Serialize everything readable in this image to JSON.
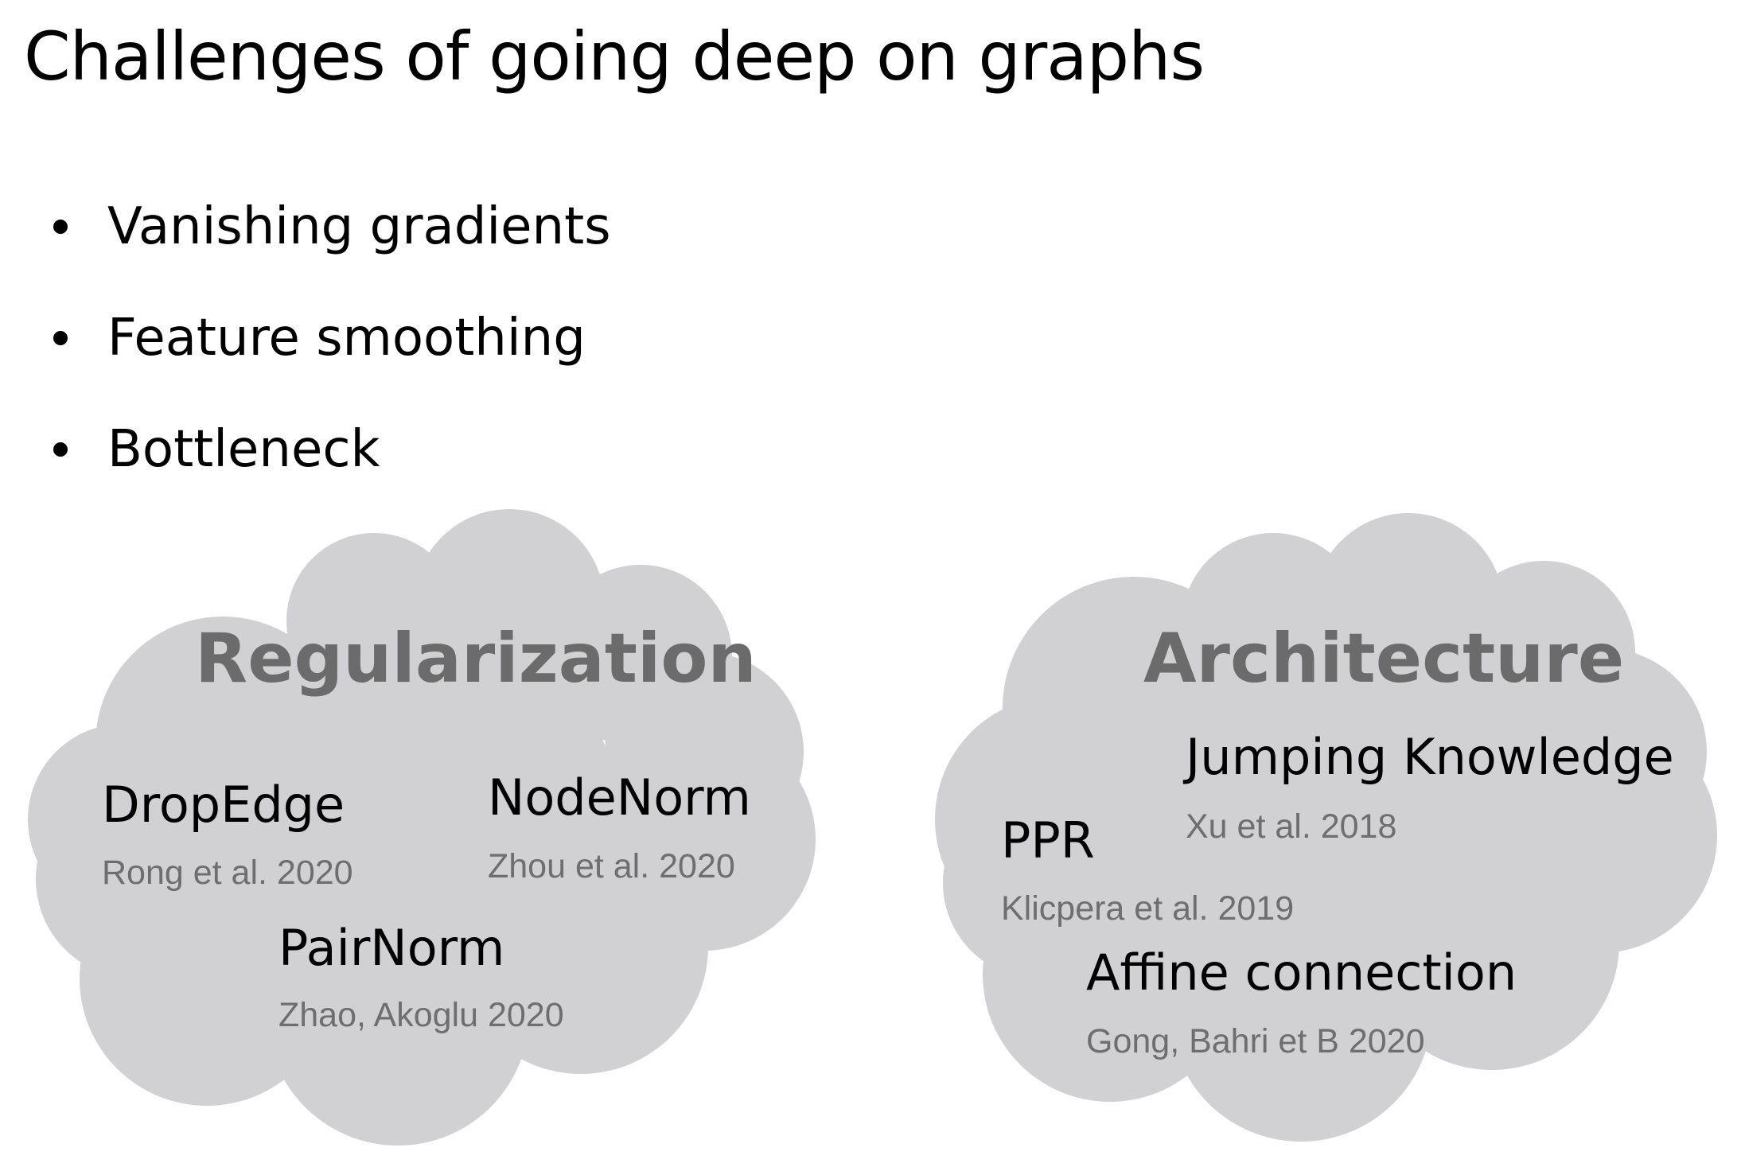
{
  "title": "Challenges of going deep on graphs",
  "bullets": [
    "Vanishing gradients",
    "Feature smoothing",
    "Bottleneck"
  ],
  "cloud_color": "#d1d1d3",
  "regularization": {
    "heading": "Regularization",
    "methods": [
      {
        "name": "DropEdge",
        "citation": "Rong et al. 2020"
      },
      {
        "name": "NodeNorm",
        "citation": "Zhou et al. 2020"
      },
      {
        "name": "PairNorm",
        "citation": "Zhao, Akoglu 2020"
      }
    ]
  },
  "architecture": {
    "heading": "Architecture",
    "methods": [
      {
        "name": "Jumping Knowledge",
        "citation": "Xu et al. 2018"
      },
      {
        "name": "PPR",
        "citation": "Klicpera et al. 2019"
      },
      {
        "name": "Affine connection",
        "citation": "Gong, Bahri et B 2020"
      }
    ]
  }
}
